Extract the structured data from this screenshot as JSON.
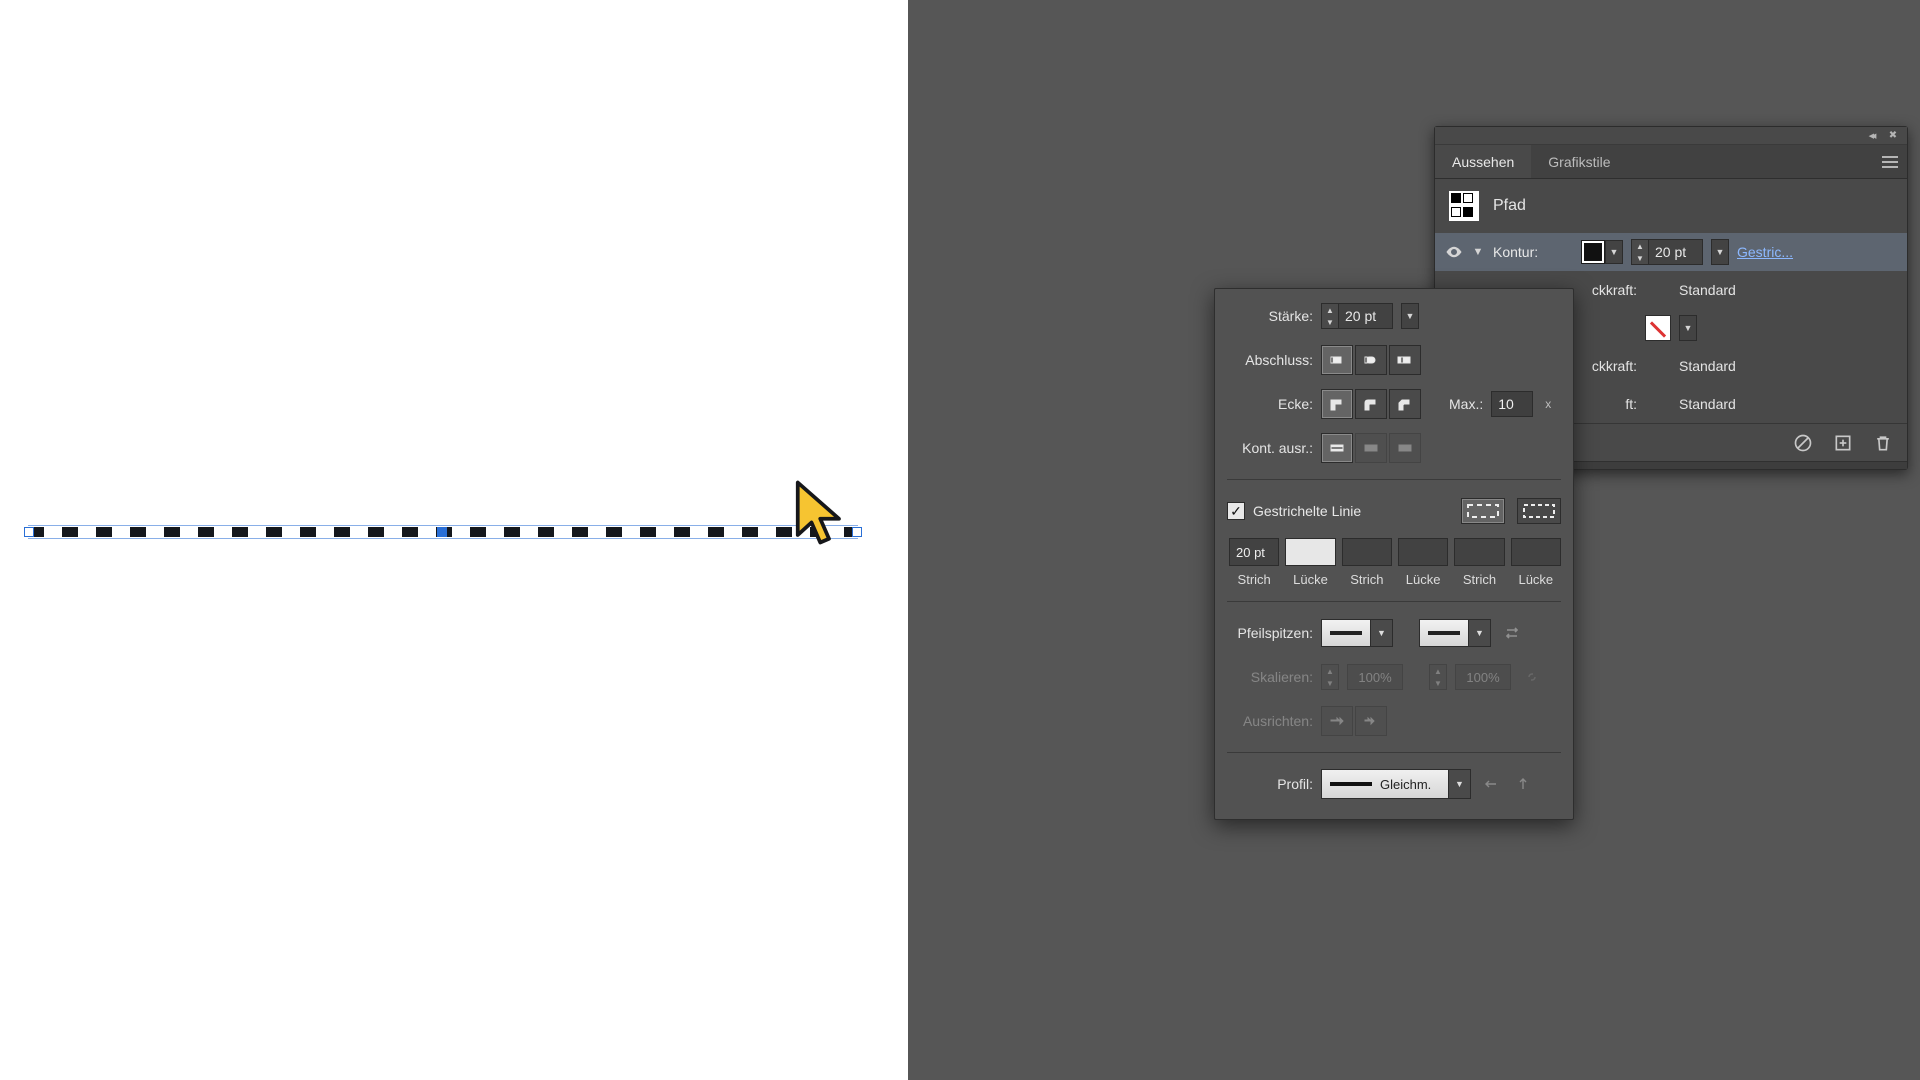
{
  "appearance": {
    "tabs": [
      "Aussehen",
      "Grafikstile"
    ],
    "object_label": "Pfad",
    "stroke": {
      "label": "Kontur",
      "weight": "20 pt",
      "extra": "Gestric..."
    },
    "rows": [
      {
        "label_tail": "ckkraft:",
        "value": "Standard"
      },
      {
        "label_tail": "ckkraft:",
        "value": "Standard"
      },
      {
        "label_tail": "ft:",
        "value": "Standard"
      }
    ]
  },
  "stroke_panel": {
    "labels": {
      "weight": "Stärke",
      "cap": "Abschluss",
      "corner": "Ecke",
      "max": "Max.",
      "align": "Kont. ausr.",
      "dashed": "Gestrichelte Linie",
      "arrows": "Pfeilspitzen",
      "scale": "Skalieren",
      "alignTip": "Ausrichten",
      "profile": "Profil"
    },
    "weight_value": "20 pt",
    "miter_value": "10",
    "x_suffix": "x",
    "dash_fields": [
      "20 pt",
      "",
      "",
      "",
      "",
      ""
    ],
    "dash_captions": [
      "Strich",
      "Lücke",
      "Strich",
      "Lücke",
      "Strich",
      "Lücke"
    ],
    "scale_values": [
      "100%",
      "100%"
    ],
    "profile_text": "Gleichm."
  }
}
